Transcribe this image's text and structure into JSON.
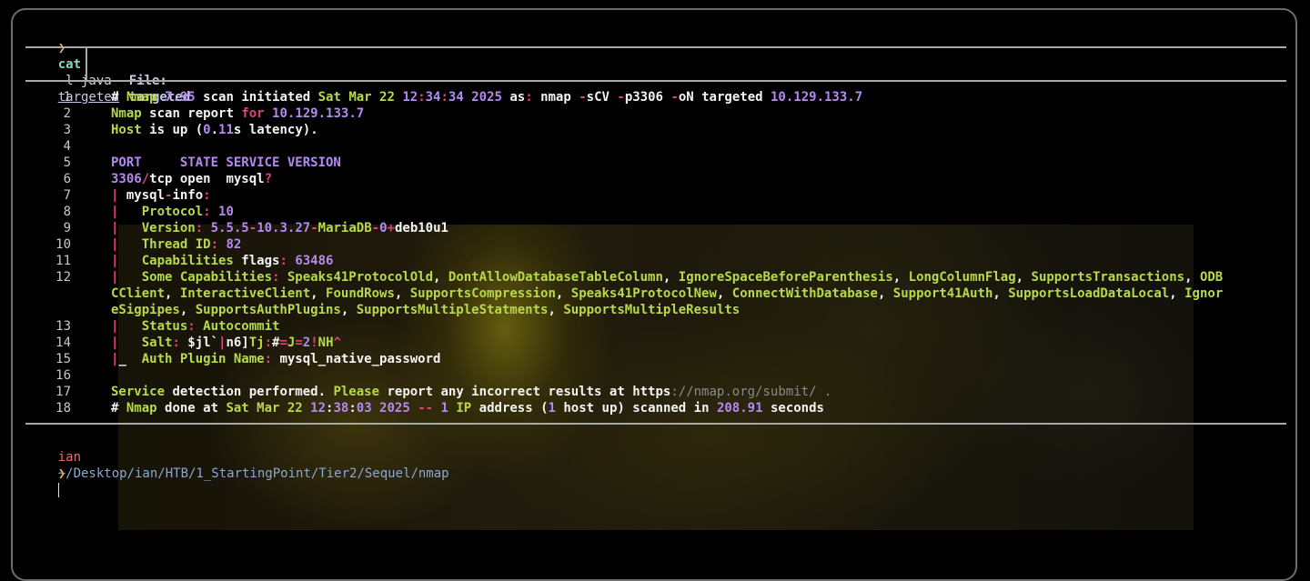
{
  "command": {
    "prompt": "❯",
    "name": "cat",
    "flags": "-l java",
    "file": "targeted"
  },
  "file_header": {
    "label": "File:",
    "name": "targeted"
  },
  "lines": [
    {
      "n": "1",
      "segs": [
        [
          "t",
          "# "
        ],
        [
          "g",
          "Nmap "
        ],
        [
          "p",
          "7.95 "
        ],
        [
          "t",
          "scan initiated "
        ],
        [
          "g",
          "Sat Mar 22 "
        ],
        [
          "p",
          "12"
        ],
        [
          "pk",
          ":"
        ],
        [
          "p",
          "34"
        ],
        [
          "pk",
          ":"
        ],
        [
          "p",
          "34 2025 "
        ],
        [
          "t",
          "as"
        ],
        [
          "pk",
          ": "
        ],
        [
          "t",
          "nmap "
        ],
        [
          "pk",
          "-"
        ],
        [
          "t",
          "sCV "
        ],
        [
          "pk",
          "-"
        ],
        [
          "t",
          "p3306 "
        ],
        [
          "pk",
          "-"
        ],
        [
          "t",
          "oN targeted "
        ],
        [
          "p",
          "10.129.133.7"
        ]
      ]
    },
    {
      "n": "2",
      "segs": [
        [
          "g",
          "Nmap "
        ],
        [
          "t",
          "scan report "
        ],
        [
          "pk",
          "for "
        ],
        [
          "p",
          "10.129.133.7"
        ]
      ]
    },
    {
      "n": "3",
      "segs": [
        [
          "g",
          "Host "
        ],
        [
          "t",
          "is up ("
        ],
        [
          "p",
          "0"
        ],
        [
          "t",
          "."
        ],
        [
          "p",
          "11"
        ],
        [
          "t",
          "s latency)."
        ]
      ]
    },
    {
      "n": "4",
      "segs": []
    },
    {
      "n": "5",
      "segs": [
        [
          "p",
          "PORT     STATE SERVICE VERSION"
        ]
      ]
    },
    {
      "n": "6",
      "segs": [
        [
          "p",
          "3306"
        ],
        [
          "pk",
          "/"
        ],
        [
          "t",
          "tcp open  mysql"
        ],
        [
          "pk",
          "?"
        ]
      ]
    },
    {
      "n": "7",
      "segs": [
        [
          "pk",
          "| "
        ],
        [
          "t",
          "mysql"
        ],
        [
          "pk",
          "-"
        ],
        [
          "t",
          "info"
        ],
        [
          "pk",
          ":"
        ]
      ]
    },
    {
      "n": "8",
      "segs": [
        [
          "pk",
          "|   "
        ],
        [
          "g",
          "Protocol"
        ],
        [
          "pk",
          ": "
        ],
        [
          "p",
          "10"
        ]
      ]
    },
    {
      "n": "9",
      "segs": [
        [
          "pk",
          "|   "
        ],
        [
          "g",
          "Version"
        ],
        [
          "pk",
          ": "
        ],
        [
          "p",
          "5.5.5"
        ],
        [
          "pk",
          "-"
        ],
        [
          "p",
          "10.3.27"
        ],
        [
          "pk",
          "-"
        ],
        [
          "g",
          "MariaDB"
        ],
        [
          "pk",
          "-"
        ],
        [
          "p",
          "0"
        ],
        [
          "pk",
          "+"
        ],
        [
          "t",
          "deb10u1"
        ]
      ]
    },
    {
      "n": "10",
      "segs": [
        [
          "pk",
          "|   "
        ],
        [
          "g",
          "Thread ID"
        ],
        [
          "pk",
          ": "
        ],
        [
          "p",
          "82"
        ]
      ]
    },
    {
      "n": "11",
      "segs": [
        [
          "pk",
          "|   "
        ],
        [
          "g",
          "Capabilities "
        ],
        [
          "t",
          "flags"
        ],
        [
          "pk",
          ": "
        ],
        [
          "p",
          "63486"
        ]
      ]
    },
    {
      "n": "12",
      "segs": [
        [
          "pk",
          "|   "
        ],
        [
          "g",
          "Some Capabilities"
        ],
        [
          "pk",
          ": "
        ],
        [
          "g",
          "Speaks41ProtocolOld"
        ],
        [
          "t",
          ", "
        ],
        [
          "g",
          "DontAllowDatabaseTableColumn"
        ],
        [
          "t",
          ", "
        ],
        [
          "g",
          "IgnoreSpaceBeforeParenthesis"
        ],
        [
          "t",
          ", "
        ],
        [
          "g",
          "LongColumnFlag"
        ],
        [
          "t",
          ", "
        ],
        [
          "g",
          "SupportsTransactions"
        ],
        [
          "t",
          ", "
        ],
        [
          "g",
          "ODB"
        ]
      ]
    },
    {
      "n": "",
      "segs": [
        [
          "g",
          "CClient"
        ],
        [
          "t",
          ", "
        ],
        [
          "g",
          "InteractiveClient"
        ],
        [
          "t",
          ", "
        ],
        [
          "g",
          "FoundRows"
        ],
        [
          "t",
          ", "
        ],
        [
          "g",
          "SupportsCompression"
        ],
        [
          "t",
          ", "
        ],
        [
          "g",
          "Speaks41ProtocolNew"
        ],
        [
          "t",
          ", "
        ],
        [
          "g",
          "ConnectWithDatabase"
        ],
        [
          "t",
          ", "
        ],
        [
          "g",
          "Support41Auth"
        ],
        [
          "t",
          ", "
        ],
        [
          "g",
          "SupportsLoadDataLocal"
        ],
        [
          "t",
          ", "
        ],
        [
          "g",
          "Ignor"
        ]
      ]
    },
    {
      "n": "",
      "segs": [
        [
          "g",
          "eSigpipes"
        ],
        [
          "t",
          ", "
        ],
        [
          "g",
          "SupportsAuthPlugins"
        ],
        [
          "t",
          ", "
        ],
        [
          "g",
          "SupportsMultipleStatments"
        ],
        [
          "t",
          ", "
        ],
        [
          "g",
          "SupportsMultipleResults"
        ]
      ]
    },
    {
      "n": "13",
      "segs": [
        [
          "pk",
          "|   "
        ],
        [
          "g",
          "Status"
        ],
        [
          "pk",
          ": "
        ],
        [
          "g",
          "Autocommit"
        ]
      ]
    },
    {
      "n": "14",
      "segs": [
        [
          "pk",
          "|   "
        ],
        [
          "g",
          "Salt"
        ],
        [
          "pk",
          ": "
        ],
        [
          "t",
          "$jl`"
        ],
        [
          "pk",
          "|"
        ],
        [
          "t",
          "n6]"
        ],
        [
          "g",
          "Tj"
        ],
        [
          "pk",
          ":"
        ],
        [
          "t",
          "#"
        ],
        [
          "pk",
          "="
        ],
        [
          "g",
          "J"
        ],
        [
          "pk",
          "="
        ],
        [
          "p",
          "2"
        ],
        [
          "pk",
          "!"
        ],
        [
          "g",
          "NH"
        ],
        [
          "pk",
          "^"
        ]
      ]
    },
    {
      "n": "15",
      "segs": [
        [
          "pk",
          "|"
        ],
        [
          "t",
          "_  "
        ],
        [
          "g",
          "Auth Plugin Name"
        ],
        [
          "pk",
          ": "
        ],
        [
          "t",
          "mysql_native_password"
        ]
      ]
    },
    {
      "n": "16",
      "segs": []
    },
    {
      "n": "17",
      "segs": [
        [
          "g",
          "Service "
        ],
        [
          "t",
          "detection performed. "
        ],
        [
          "g",
          "Please "
        ],
        [
          "t",
          "report any incorrect results at https"
        ],
        [
          "gr",
          "://nmap.org/submit/ ."
        ]
      ]
    },
    {
      "n": "18",
      "segs": [
        [
          "t",
          "# "
        ],
        [
          "g",
          "Nmap "
        ],
        [
          "t",
          "done at "
        ],
        [
          "g",
          "Sat Mar 22 "
        ],
        [
          "p",
          "12"
        ],
        [
          "t",
          ":"
        ],
        [
          "p",
          "38"
        ],
        [
          "t",
          ":"
        ],
        [
          "p",
          "03 2025 "
        ],
        [
          "pk",
          "-- "
        ],
        [
          "p",
          "1 "
        ],
        [
          "g",
          "IP "
        ],
        [
          "t",
          "address ("
        ],
        [
          "p",
          "1 "
        ],
        [
          "t",
          "host up) scanned in "
        ],
        [
          "p",
          "208.91 "
        ],
        [
          "t",
          "seconds"
        ]
      ]
    }
  ],
  "footer": {
    "user": "ian",
    "path": "~/Desktop/ian/HTB/1_StartingPoint/Tier2/Sequel/nmap",
    "prompt": "❯"
  }
}
